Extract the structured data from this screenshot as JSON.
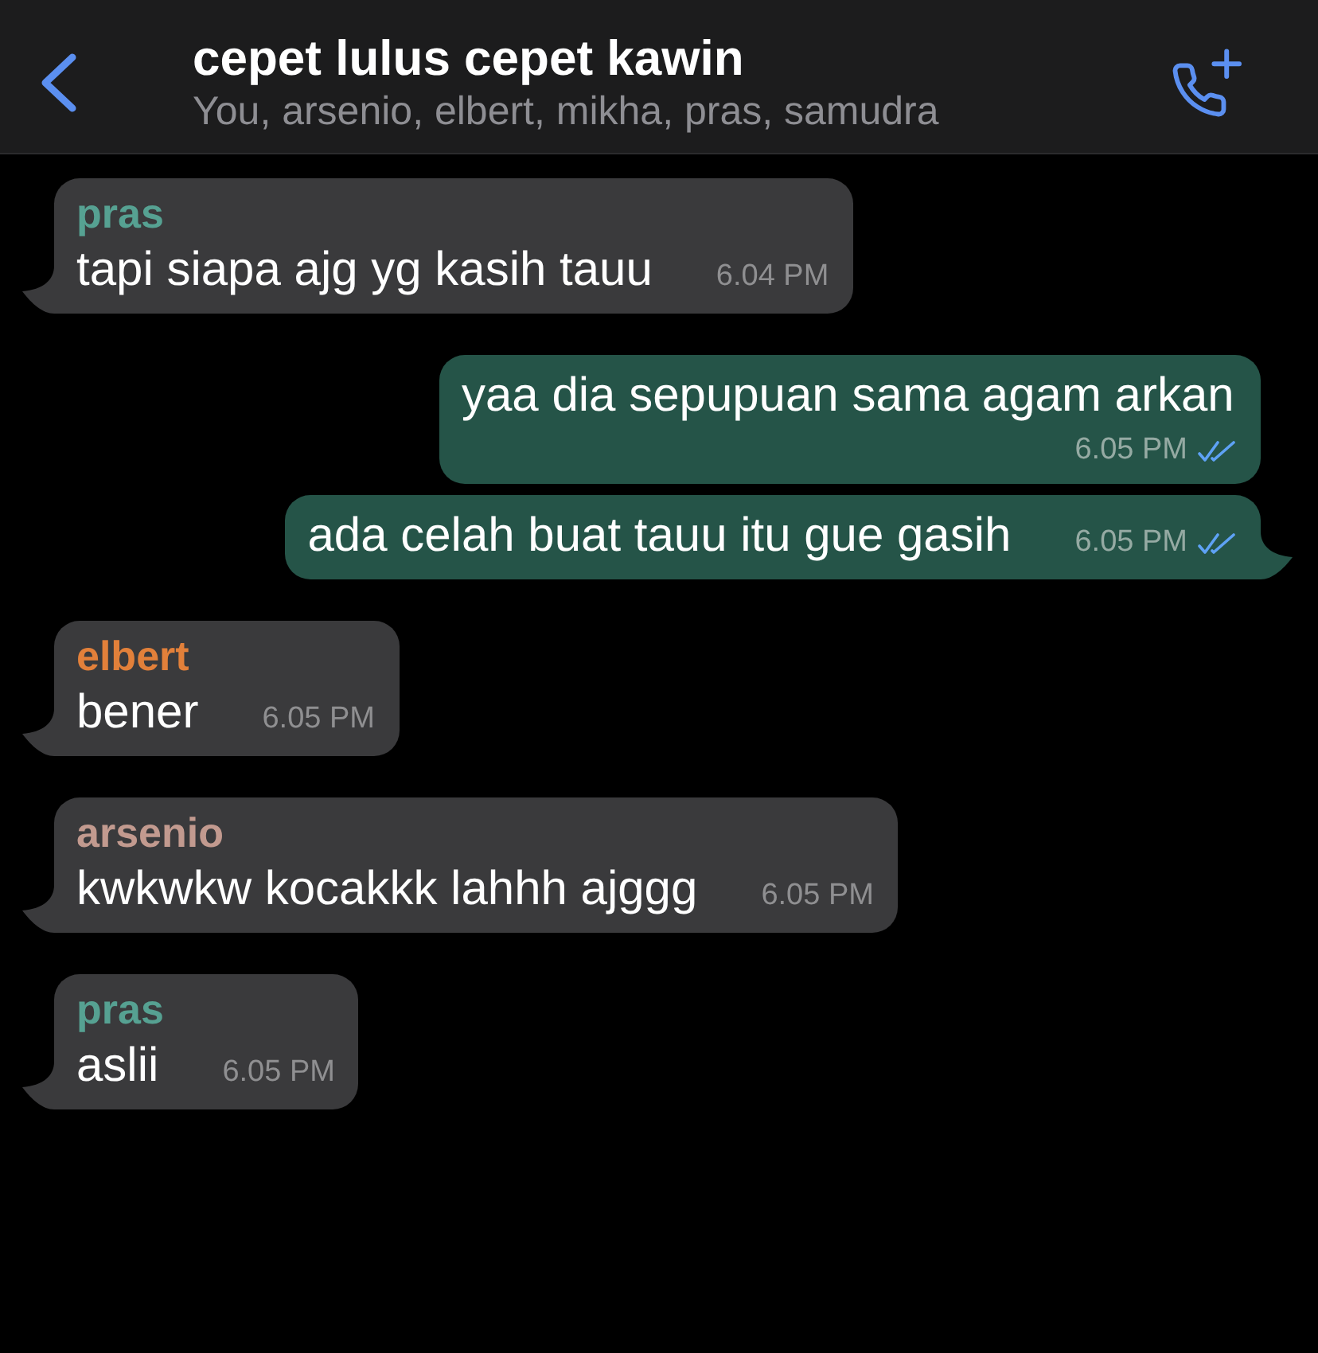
{
  "header": {
    "title": "cepet lulus cepet kawin",
    "members": "You, arsenio, elbert, mikha, pras, samudra"
  },
  "messages": [
    {
      "kind": "incoming",
      "sender": "pras",
      "color": "#56a192",
      "text": "tapi siapa ajg yg kasih tauu",
      "time": "6.04 PM"
    },
    {
      "kind": "outgoing",
      "text": "yaa dia sepupuan sama agam arkan",
      "time": "6.05 PM",
      "read": true
    },
    {
      "kind": "outgoing",
      "text": "ada celah buat tauu itu gue gasih",
      "time": "6.05 PM",
      "read": true
    },
    {
      "kind": "incoming",
      "sender": "elbert",
      "color": "#e2803a",
      "text": "bener",
      "time": "6.05 PM"
    },
    {
      "kind": "incoming",
      "sender": "arsenio",
      "color": "#c29a8f",
      "text": "kwkwkw kocakkk lahhh ajggg",
      "time": "6.05 PM"
    },
    {
      "kind": "incoming",
      "sender": "pras",
      "color": "#56a192",
      "text": "aslii",
      "time": "6.05 PM"
    }
  ]
}
